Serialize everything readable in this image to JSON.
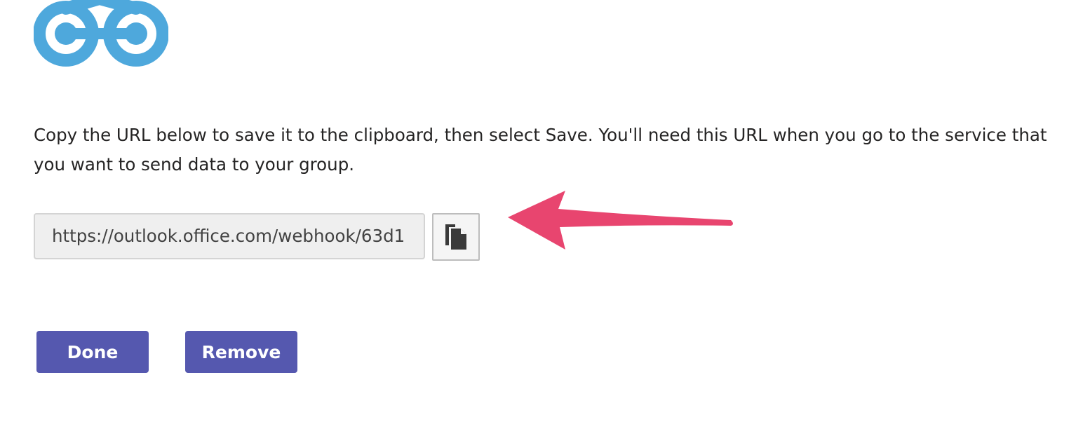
{
  "logo": {
    "icon": "webhook-logo-icon",
    "color": "#4ea8dc"
  },
  "instructions": "Copy the URL below to save it to the clipboard, then select Save. You'll need this URL when you go to the service that you want to send data to your group.",
  "url_field": {
    "value": "https://outlook.office.com/webhook/63d1"
  },
  "copy_button": {
    "icon": "copy-icon"
  },
  "annotation": {
    "icon": "arrow-pointer-icon",
    "color": "#e8456f"
  },
  "actions": {
    "done_label": "Done",
    "remove_label": "Remove",
    "color": "#5558af"
  }
}
